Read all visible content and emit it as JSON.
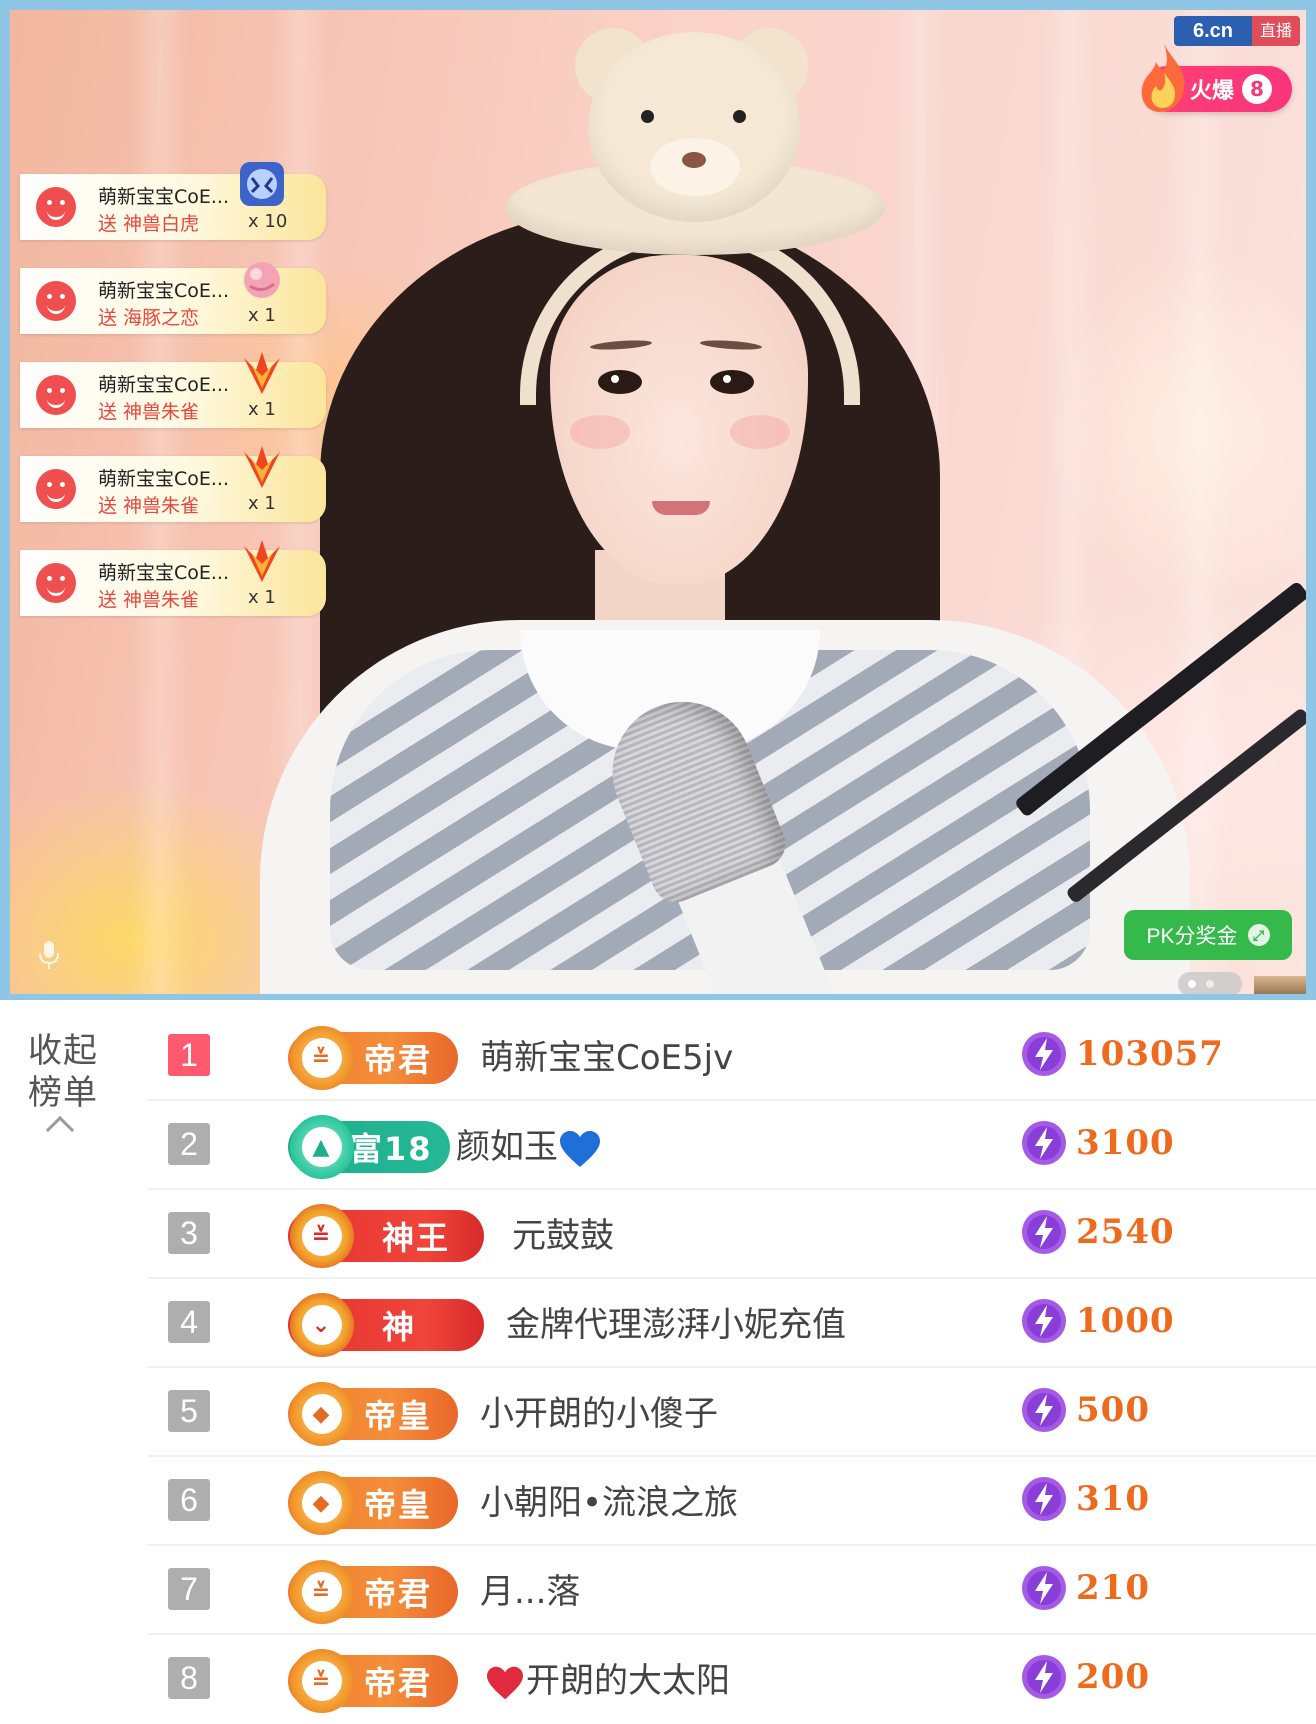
{
  "logo": {
    "site": "6.cn",
    "live": "直播"
  },
  "hot_badge": {
    "label": "火爆",
    "count": "8"
  },
  "gift_feed": [
    {
      "user": "萌新宝宝CoE...",
      "action": "送 神兽白虎",
      "count": "x 10",
      "gift_icon": "white-tiger-gift-icon"
    },
    {
      "user": "萌新宝宝CoE...",
      "action": "送 海豚之恋",
      "count": "x 1",
      "gift_icon": "dolphin-love-gift-icon"
    },
    {
      "user": "萌新宝宝CoE...",
      "action": "送 神兽朱雀",
      "count": "x 1",
      "gift_icon": "vermilion-bird-gift-icon"
    },
    {
      "user": "萌新宝宝CoE...",
      "action": "送 神兽朱雀",
      "count": "x 1",
      "gift_icon": "vermilion-bird-gift-icon"
    },
    {
      "user": "萌新宝宝CoE...",
      "action": "送 神兽朱雀",
      "count": "x 1",
      "gift_icon": "vermilion-bird-gift-icon"
    }
  ],
  "pk_button": {
    "label": "PK分奖金"
  },
  "collapse": {
    "label": "收起\n榜单"
  },
  "leaderboard": [
    {
      "rank": "1",
      "badge": "帝君",
      "badge_style": "orange",
      "user": "萌新宝宝CoE5jv",
      "amount": "103057"
    },
    {
      "rank": "2",
      "badge": "富18",
      "badge_style": "green",
      "user": "颜如玉",
      "suffix_icon": "blue-heart-icon",
      "amount": "3100"
    },
    {
      "rank": "3",
      "badge": "神王",
      "badge_style": "red",
      "user": "元鼓鼓",
      "amount": "2540"
    },
    {
      "rank": "4",
      "badge": "神",
      "badge_style": "red",
      "user": "金牌代理澎湃小妮充值",
      "amount": "1000"
    },
    {
      "rank": "5",
      "badge": "帝皇",
      "badge_style": "orange",
      "user": "小开朗的小傻子",
      "amount": "500"
    },
    {
      "rank": "6",
      "badge": "帝皇",
      "badge_style": "orange",
      "user": "小朝阳•流浪之旅",
      "amount": "310"
    },
    {
      "rank": "7",
      "badge": "帝君",
      "badge_style": "orange",
      "user": "月...落",
      "amount": "210"
    },
    {
      "rank": "8",
      "badge": "帝君",
      "badge_style": "orange",
      "user": "开朗的大太阳",
      "prefix_icon": "red-heart-icon",
      "amount": "200"
    }
  ],
  "colors": {
    "frame": "#8fc6e6",
    "rank_first": "#ff5a6e",
    "rank_other": "#aeaeae",
    "amount": "#ee6a1d",
    "pk_button": "#35b94a",
    "gift_action": "#e8473e"
  }
}
